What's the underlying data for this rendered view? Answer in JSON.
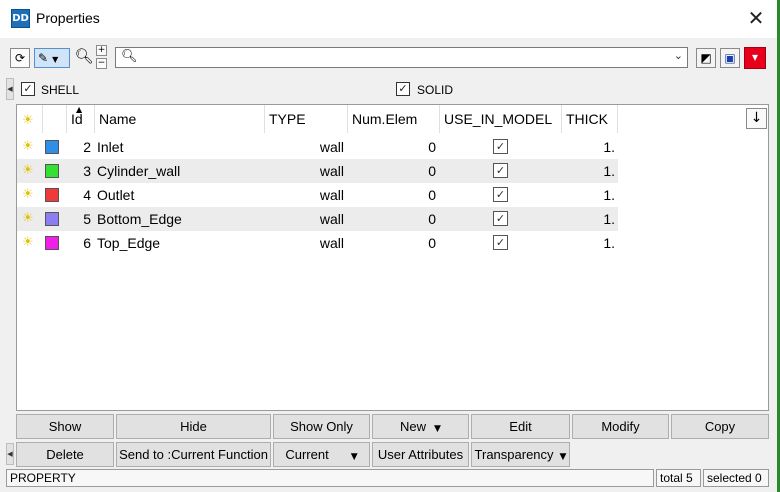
{
  "window": {
    "title": "Properties",
    "close_glyph": "✕",
    "app_icon_text": "DD"
  },
  "toolbar": {
    "search_value": "",
    "search_placeholder": "",
    "icons": [
      "refresh-icon",
      "highlight-dropdown-icon",
      "zoom-icon",
      "zoom-in-icon",
      "zoom-out-icon",
      "search-icon",
      "dropdown-icon",
      "edit-doc-icon",
      "save-icon",
      "color-pick-icon"
    ]
  },
  "filters": [
    {
      "label": "SHELL",
      "checked": true
    },
    {
      "label": "SOLID",
      "checked": true
    }
  ],
  "table": {
    "columns": [
      "Id",
      "Name",
      "TYPE",
      "Num.Elem",
      "USE_IN_MODEL",
      "THICK"
    ],
    "rows": [
      {
        "id": "2",
        "name": "Inlet",
        "type": "wall",
        "num_elem": "0",
        "use_in_model": true,
        "thick": "1.",
        "color": "#2f8fe8"
      },
      {
        "id": "3",
        "name": "Cylinder_wall",
        "type": "wall",
        "num_elem": "0",
        "use_in_model": true,
        "thick": "1.",
        "color": "#33e033"
      },
      {
        "id": "4",
        "name": "Outlet",
        "type": "wall",
        "num_elem": "0",
        "use_in_model": true,
        "thick": "1.",
        "color": "#f03a3a"
      },
      {
        "id": "5",
        "name": "Bottom_Edge",
        "type": "wall",
        "num_elem": "0",
        "use_in_model": true,
        "thick": "1.",
        "color": "#8a7ef0"
      },
      {
        "id": "6",
        "name": "Top_Edge",
        "type": "wall",
        "num_elem": "0",
        "use_in_model": true,
        "thick": "1.",
        "color": "#f020e8"
      }
    ]
  },
  "buttons_row1": [
    "Show",
    "Hide",
    "Show Only",
    "New",
    "Edit",
    "Modify",
    "Copy"
  ],
  "buttons_row2": [
    "Delete",
    "Send to :Current Function",
    "Current",
    "User Attributes",
    "Transparency"
  ],
  "status": {
    "entity": "PROPERTY",
    "total": "total 5",
    "selected": "selected 0"
  },
  "colors": {
    "accent_green": "#2a8a2a",
    "save_red": "#e8001a"
  }
}
